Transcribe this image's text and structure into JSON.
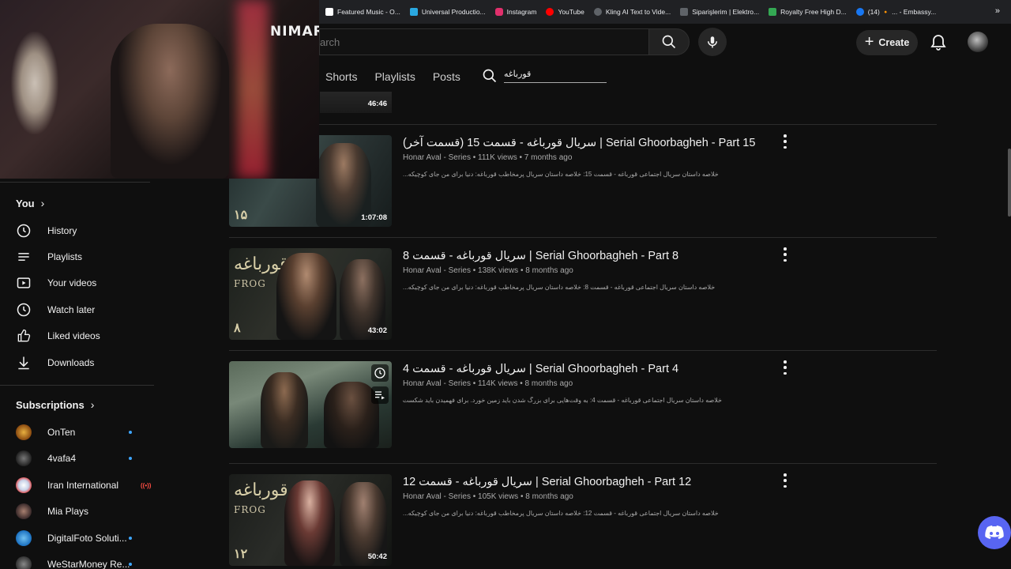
{
  "bookmarks": [
    {
      "label": "Featured Music - O...",
      "color": "#ffffff"
    },
    {
      "label": "Universal Productio...",
      "color": "#2aa8e0"
    },
    {
      "label": "Instagram",
      "color": "#e1306c"
    },
    {
      "label": "YouTube",
      "color": "#ff0000"
    },
    {
      "label": "Kling AI Text to Vide...",
      "color": "#9aa0a6"
    },
    {
      "label": "Siparişlerim | Elektro...",
      "color": "#9aa0a6"
    },
    {
      "label": "Royalty Free High D...",
      "color": "#34a853"
    },
    {
      "label": "(14) 🔸 ... - Embassy...",
      "color": "#1877f2"
    }
  ],
  "webcam": {
    "sign": "NIMAR"
  },
  "header": {
    "search_placeholder": "arch",
    "create_label": "Create"
  },
  "tabs": [
    "Shorts",
    "Playlists",
    "Posts"
  ],
  "tab_search_query": "قورباغه",
  "sidebar": {
    "you_heading": "You",
    "items": [
      {
        "label": "History",
        "icon": "history-icon"
      },
      {
        "label": "Playlists",
        "icon": "playlists-icon"
      },
      {
        "label": "Your videos",
        "icon": "your-videos-icon"
      },
      {
        "label": "Watch later",
        "icon": "watch-later-icon"
      },
      {
        "label": "Liked videos",
        "icon": "thumbs-up-icon"
      },
      {
        "label": "Downloads",
        "icon": "download-icon"
      }
    ],
    "subscriptions_heading": "Subscriptions",
    "subscriptions": [
      {
        "name": "OnTen",
        "indicator": "dot",
        "color": "#c98a2a"
      },
      {
        "name": "4vafa4",
        "indicator": "dot",
        "color": "#3a3a3a"
      },
      {
        "name": "Iran International",
        "indicator": "live",
        "color": "#d0d8e8"
      },
      {
        "name": "Mia Plays",
        "indicator": "none",
        "color": "#6a4a4a"
      },
      {
        "name": "DigitalFoto Soluti...",
        "indicator": "dot",
        "color": "#2a8ad0"
      },
      {
        "name": "WeStarMoney Re...",
        "indicator": "dot",
        "color": "#444444"
      }
    ]
  },
  "partial_video": {
    "duration": "46:46"
  },
  "videos": [
    {
      "title": "سریال قورباغه - قسمت 15 (قسمت آخر) | Serial Ghoorbagheh - Part 15",
      "channel": "Honar Aval - Series",
      "views": "111K views",
      "age": "7 months ago",
      "description": "خلاصه داستان سریال اجتماعی قورباغه - قسمت 15: خلاصه داستان سریال پرمخاطب قورباغه: دنیا برای من جای کوچیکه...",
      "duration": "1:07:08",
      "ep_label": "۱۵"
    },
    {
      "title": "سریال قورباغه - قسمت 8 | Serial Ghoorbagheh - Part 8",
      "channel": "Honar Aval - Series",
      "views": "138K views",
      "age": "8 months ago",
      "description": "خلاصه داستان سریال اجتماعی قورباغه - قسمت 8: خلاصه داستان سریال پرمخاطب قورباغه: دنیا برای من جای کوچیکه...",
      "duration": "43:02",
      "ep_label": "۸"
    },
    {
      "title": "سریال قورباغه - قسمت 4 | Serial Ghoorbagheh - Part 4",
      "channel": "Honar Aval - Series",
      "views": "114K views",
      "age": "8 months ago",
      "description": "خلاصه داستان سریال اجتماعی قورباغه - قسمت 4: به وقت‌هایی برای بزرگ شدن باید زمین خورد. برای فهمیدن باید شکست...",
      "duration": "",
      "ep_label": ""
    },
    {
      "title": "سریال قورباغه - قسمت 12 | Serial Ghoorbagheh - Part 12",
      "channel": "Honar Aval - Series",
      "views": "105K views",
      "age": "8 months ago",
      "description": "خلاصه داستان سریال اجتماعی قورباغه - قسمت 12: خلاصه داستان سریال پرمخاطب قورباغه: دنیا برای من جای کوچیکه...",
      "duration": "50:42",
      "ep_label": "۱۲"
    }
  ],
  "thumb_text": {
    "logo": "قورباغه",
    "frog": "FROG"
  },
  "separator": "•"
}
